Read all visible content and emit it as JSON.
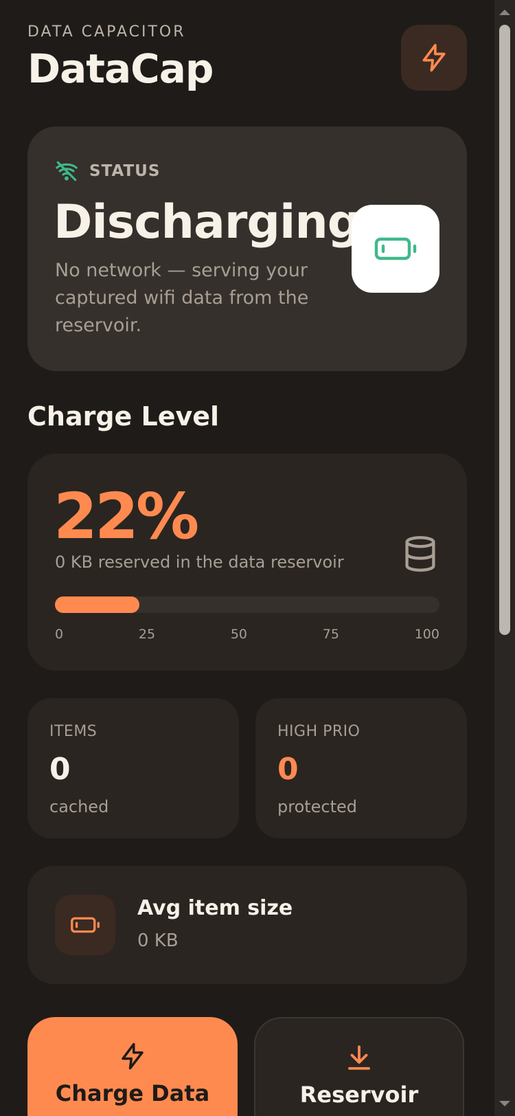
{
  "header": {
    "eyebrow": "DATA CAPACITOR",
    "title": "DataCap",
    "action_icon": "lightning-icon"
  },
  "status": {
    "label": "STATUS",
    "title": "Discharging",
    "description": "No network — serving your captured wifi data from the reservoir.",
    "icons": {
      "network": "wifi-off-icon",
      "state": "battery-low-icon"
    }
  },
  "charge": {
    "section_title": "Charge Level",
    "percent_label": "22%",
    "percent_value": 22,
    "subtitle": "0 KB reserved in the data reservoir",
    "ticks": [
      "0",
      "25",
      "50",
      "75",
      "100"
    ],
    "icon": "database-icon"
  },
  "stats": {
    "items": {
      "label": "ITEMS",
      "value": "0",
      "unit": "cached"
    },
    "high_prio": {
      "label": "HIGH PRIO",
      "value": "0",
      "unit": "protected"
    }
  },
  "avg": {
    "icon": "battery-icon",
    "title": "Avg item size",
    "value": "0 KB"
  },
  "actions": {
    "charge": {
      "label": "Charge Data",
      "icon": "lightning-icon"
    },
    "reservoir": {
      "label": "Reservoir",
      "icon": "download-icon"
    }
  },
  "colors": {
    "accent": "#ff8a50",
    "background": "#1f1b18",
    "card": "#2a2521",
    "status_green": "#3fb98a"
  }
}
